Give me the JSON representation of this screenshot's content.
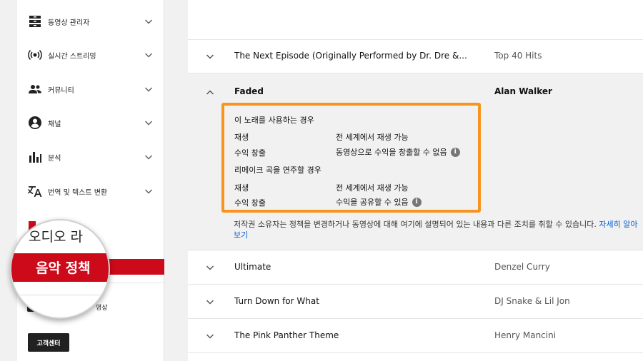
{
  "sidebar": {
    "items": [
      {
        "label": "동영상 관리자",
        "icon": "video-manager-icon"
      },
      {
        "label": "실시간 스트리밍",
        "icon": "live-stream-icon"
      },
      {
        "label": "커뮤니티",
        "icon": "community-icon"
      },
      {
        "label": "채널",
        "icon": "channel-icon"
      },
      {
        "label": "분석",
        "icon": "analytics-icon"
      },
      {
        "label": "번역 및 텍스트 변환",
        "icon": "translate-icon"
      }
    ],
    "video_fragment": "영상",
    "help_button": "고객센터"
  },
  "magnifier": {
    "audio_label": "오디오 라",
    "music_policy_label": "음악 정책"
  },
  "tracks": [
    {
      "title": "The Next Episode (Originally Performed by Dr. Dre &...",
      "artist": "Top 40 Hits"
    },
    {
      "title": "Faded",
      "artist": "Alan Walker",
      "expanded": true
    },
    {
      "title": "Ultimate",
      "artist": "Denzel Curry"
    },
    {
      "title": "Turn Down for What",
      "artist": "DJ Snake & Lil Jon"
    },
    {
      "title": "The Pink Panther Theme",
      "artist": "Henry Mancini"
    }
  ],
  "policy": {
    "use_heading": "이 노래를 사용하는 경우",
    "use_play_key": "재생",
    "use_play_val": "전 세계에서 재생 가능",
    "use_monetize_key": "수익 창출",
    "use_monetize_val": "동영상으로 수익을 창출할 수 없음",
    "cover_heading": "리메이크 곡을 연주할 경우",
    "cover_play_key": "재생",
    "cover_play_val": "전 세계에서 재생 가능",
    "cover_monetize_key": "수익 창출",
    "cover_monetize_val": "수익을 공유할 수 있음",
    "notice": "저작권 소유자는 정책을 변경하거나 동영상에 대해 여기에 설명되어 있는 내용과 다른 조치를 취할 수 있습니다.",
    "learn_more": "자세히 알아보기"
  },
  "colors": {
    "highlight_border": "#f7941d",
    "brand_red": "#cc0a1a",
    "link_blue": "#065fd4"
  }
}
